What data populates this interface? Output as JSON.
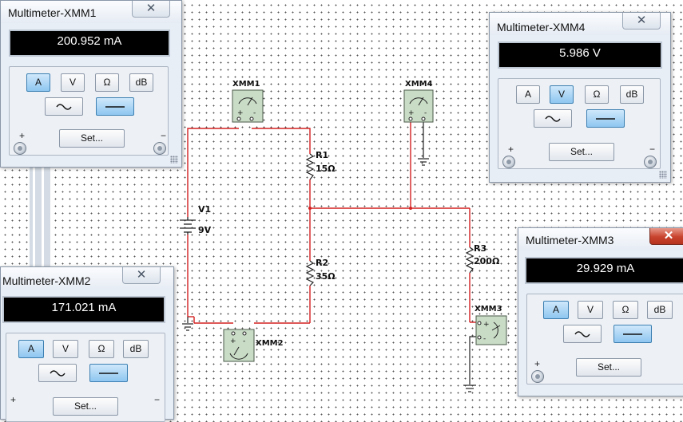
{
  "schematic": {
    "components": {
      "xmm1": "XMM1",
      "xmm2": "XMM2",
      "xmm3": "XMM3",
      "xmm4": "XMM4",
      "r1_name": "R1",
      "r1_value": "15Ω",
      "r2_name": "R2",
      "r2_value": "35Ω",
      "r3_name": "R3",
      "r3_value": "200Ω",
      "v1_name": "V1",
      "v1_value": "9V"
    },
    "wire_color": "#d42020"
  },
  "multimeters": {
    "xmm1": {
      "title": "Multimeter-XMM1",
      "reading": "200.952 mA",
      "buttons": [
        "A",
        "V",
        "Ω",
        "dB"
      ],
      "active_mode": "A",
      "set_label": "Set...",
      "plus": "+",
      "minus": "−"
    },
    "xmm2": {
      "title": "Multimeter-XMM2",
      "reading": "171.021 mA",
      "buttons": [
        "A",
        "V",
        "Ω",
        "dB"
      ],
      "active_mode": "A",
      "set_label": "Set...",
      "plus": "+",
      "minus": "−"
    },
    "xmm3": {
      "title": "Multimeter-XMM3",
      "reading": "29.929 mA",
      "buttons": [
        "A",
        "V",
        "Ω",
        "dB"
      ],
      "active_mode": "A",
      "set_label": "Set...",
      "plus": "+",
      "minus": "−"
    },
    "xmm4": {
      "title": "Multimeter-XMM4",
      "reading": "5.986 V",
      "buttons": [
        "A",
        "V",
        "Ω",
        "dB"
      ],
      "active_mode": "V",
      "set_label": "Set...",
      "plus": "+",
      "minus": "−"
    }
  }
}
